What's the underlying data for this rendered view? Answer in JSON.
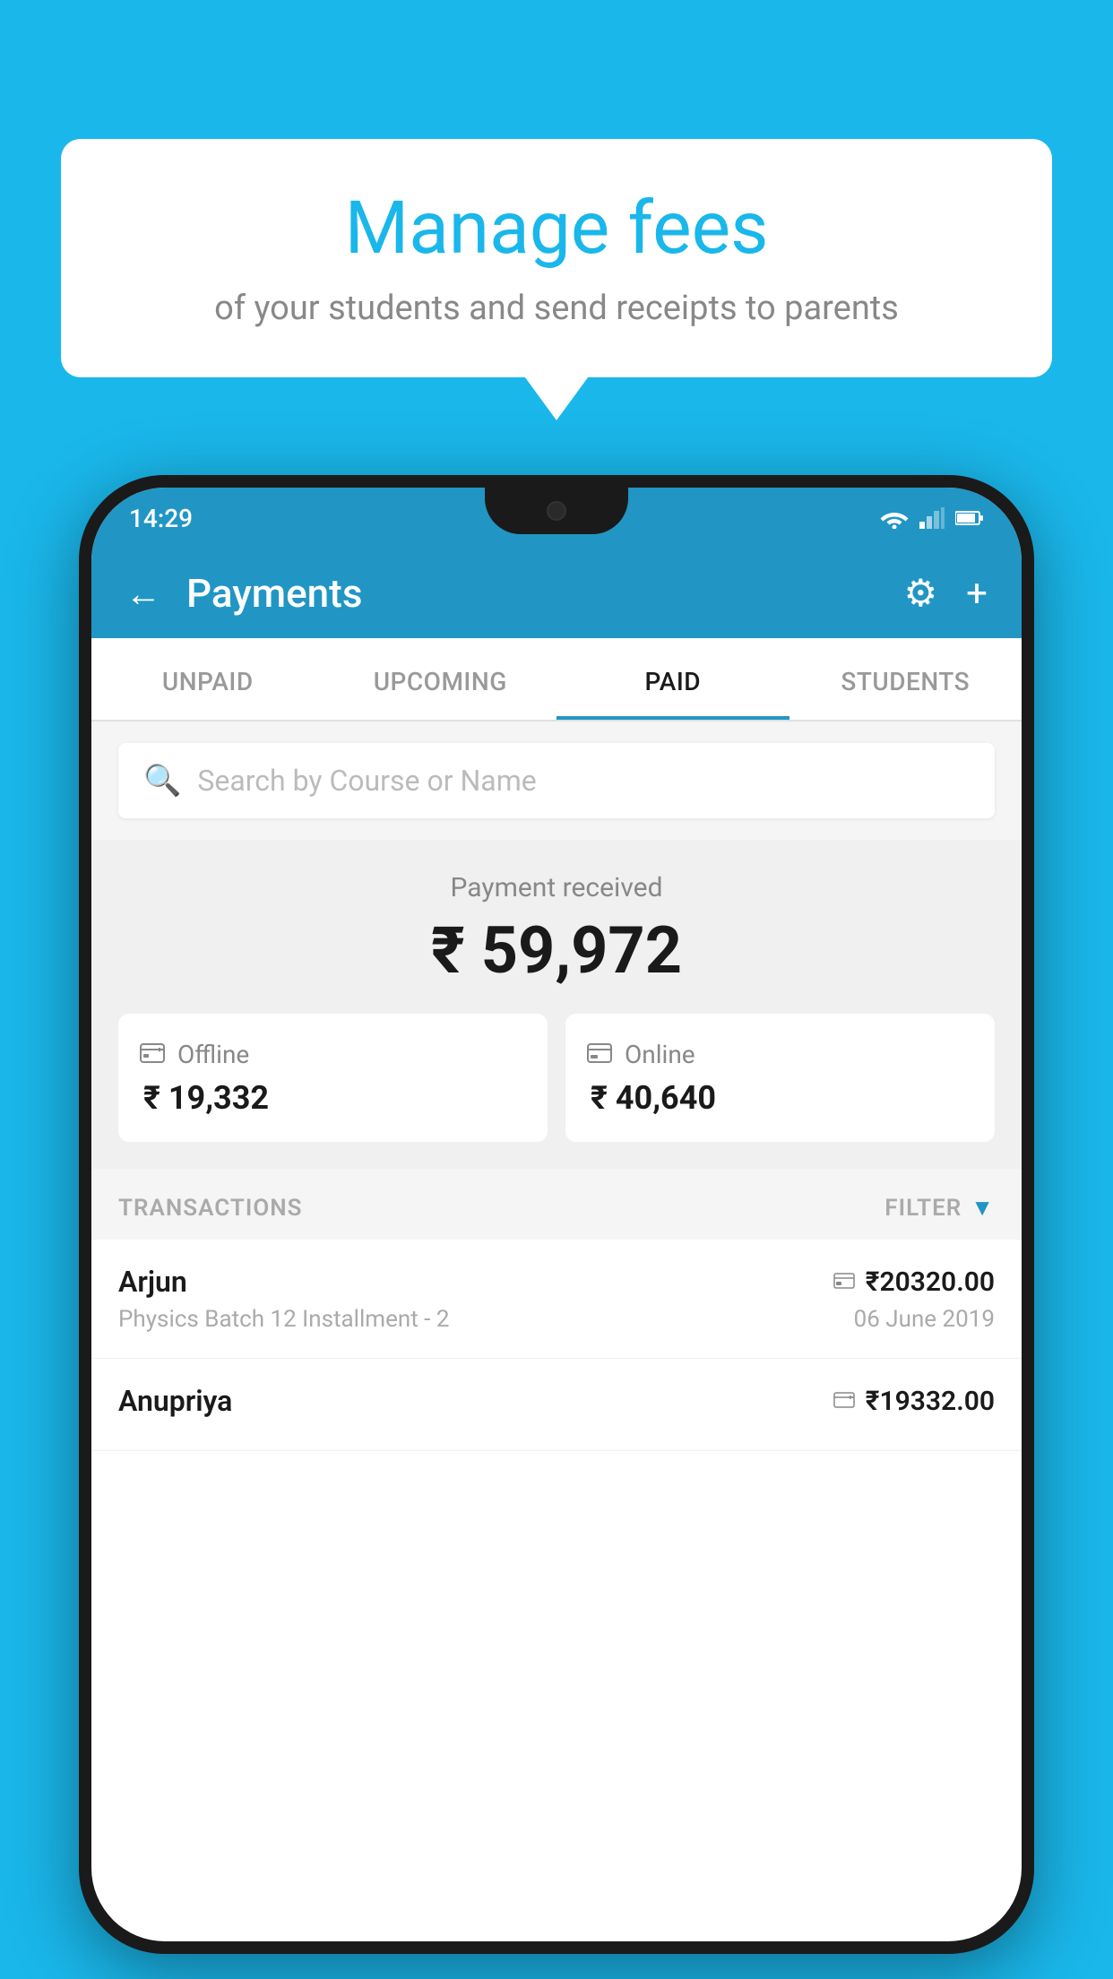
{
  "background_color": "#1ab7ea",
  "speech_bubble": {
    "title": "Manage fees",
    "subtitle": "of your students and send receipts to parents"
  },
  "phone": {
    "status_bar": {
      "time": "14:29"
    },
    "header": {
      "title": "Payments",
      "back_label": "←",
      "settings_label": "⚙",
      "add_label": "+"
    },
    "tabs": [
      {
        "label": "UNPAID",
        "active": false
      },
      {
        "label": "UPCOMING",
        "active": false
      },
      {
        "label": "PAID",
        "active": true
      },
      {
        "label": "STUDENTS",
        "active": false
      }
    ],
    "search": {
      "placeholder": "Search by Course or Name"
    },
    "payment_summary": {
      "label": "Payment received",
      "total": "₹ 59,972",
      "offline_label": "Offline",
      "offline_amount": "₹ 19,332",
      "online_label": "Online",
      "online_amount": "₹ 40,640"
    },
    "transactions": {
      "header_label": "TRANSACTIONS",
      "filter_label": "FILTER",
      "items": [
        {
          "name": "Arjun",
          "description": "Physics Batch 12 Installment - 2",
          "amount": "₹20320.00",
          "date": "06 June 2019",
          "type": "online"
        },
        {
          "name": "Anupriya",
          "description": "",
          "amount": "₹19332.00",
          "date": "",
          "type": "offline"
        }
      ]
    }
  }
}
